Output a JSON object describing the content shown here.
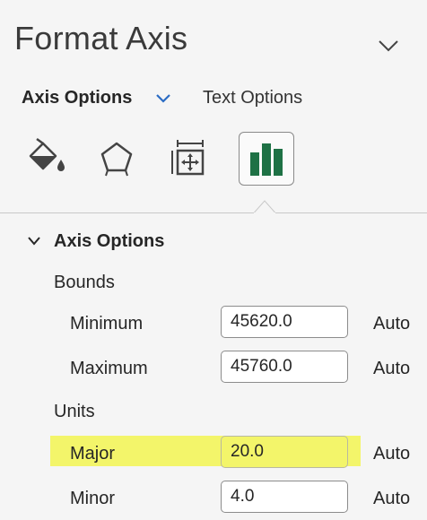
{
  "panel": {
    "title": "Format Axis"
  },
  "tabs": {
    "axis_options": "Axis Options",
    "text_options": "Text Options"
  },
  "section": {
    "title": "Axis Options",
    "bounds": {
      "label": "Bounds",
      "minimum": {
        "label": "Minimum",
        "value": "45620.0",
        "auto": "Auto"
      },
      "maximum": {
        "label": "Maximum",
        "value": "45760.0",
        "auto": "Auto"
      }
    },
    "units": {
      "label": "Units",
      "major": {
        "label": "Major",
        "value": "20.0",
        "auto": "Auto"
      },
      "minor": {
        "label": "Minor",
        "value": "4.0",
        "auto": "Auto"
      }
    }
  },
  "colors": {
    "highlight": "#f3f56a",
    "accent_blue": "#2b6cc4",
    "chart_green": "#1e7145"
  }
}
